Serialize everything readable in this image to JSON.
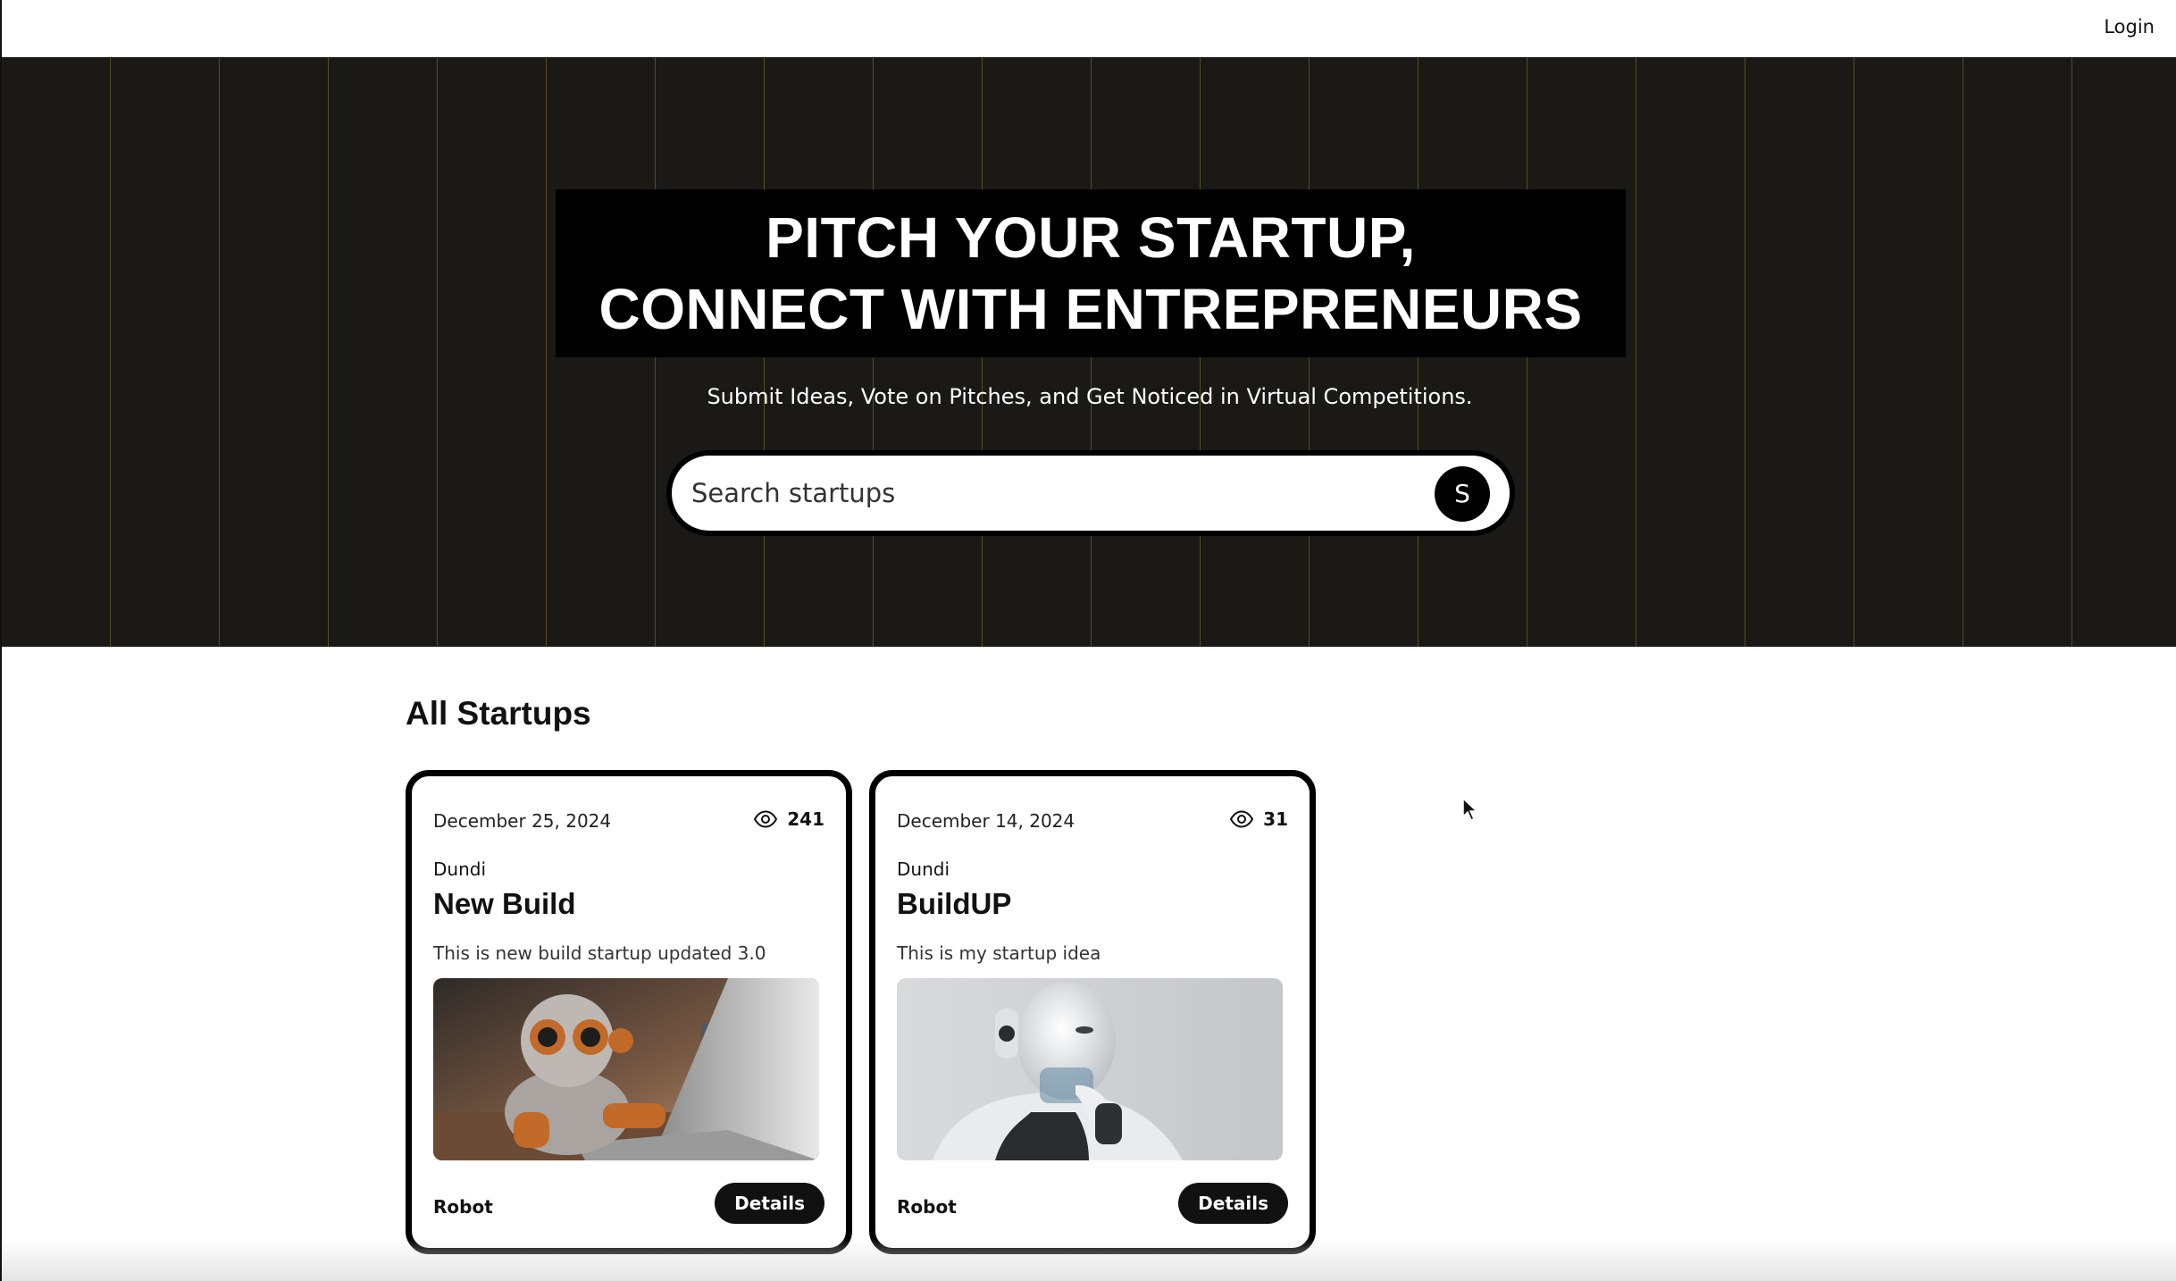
{
  "nav": {
    "login_label": "Login"
  },
  "hero": {
    "headline_line1": "PITCH YOUR STARTUP,",
    "headline_line2": "CONNECT WITH ENTREPRENEURS",
    "subtitle": "Submit Ideas, Vote on Pitches, and Get Noticed in Virtual Competitions.",
    "search": {
      "placeholder": "Search startups",
      "button_label": "S"
    }
  },
  "section": {
    "title": "All Startups"
  },
  "startups": [
    {
      "date": "December 25, 2024",
      "views": "241",
      "author": "Dundi",
      "title": "New Build",
      "description": "This is new build startup updated 3.0",
      "image_icon": "robot-with-laptop-image",
      "category": "Robot",
      "details_label": "Details"
    },
    {
      "date": "December 14, 2024",
      "views": "31",
      "author": "Dundi",
      "title": "BuildUP",
      "description": "This is my startup idea",
      "image_icon": "humanoid-robot-image",
      "category": "Robot",
      "details_label": "Details"
    }
  ],
  "colors": {
    "hero_bg": "#1a1916",
    "grid_line": "#cdaa37",
    "accent": "#000000"
  }
}
